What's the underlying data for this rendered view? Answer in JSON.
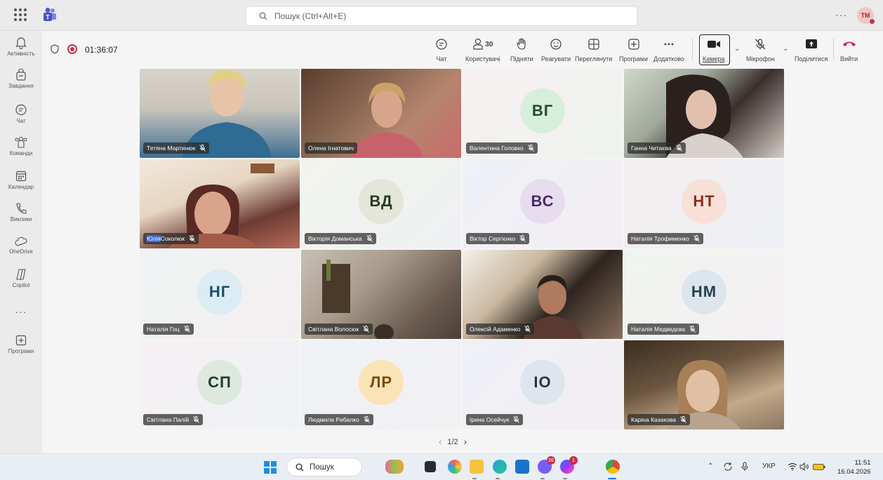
{
  "topbar": {
    "search_placeholder": "Пошук (Ctrl+Alt+E)",
    "more": "···",
    "user_initials": "TM"
  },
  "rail": [
    {
      "label": "Активність",
      "icon": "bell-icon"
    },
    {
      "label": "Завдання",
      "icon": "tasks-icon"
    },
    {
      "label": "Чат",
      "icon": "chat-icon"
    },
    {
      "label": "Команди",
      "icon": "teams-icon"
    },
    {
      "label": "Календар",
      "icon": "calendar-icon"
    },
    {
      "label": "Виклики",
      "icon": "phone-icon"
    },
    {
      "label": "OneDrive",
      "icon": "onedrive-icon"
    },
    {
      "label": "Copilot",
      "icon": "copilot-icon"
    },
    {
      "label": "···",
      "icon": "more-icon"
    },
    {
      "label": "Програми",
      "icon": "apps-add-icon"
    }
  ],
  "meeting": {
    "timer": "01:36:07",
    "controls": {
      "chat": "Чат",
      "people": "Користувачі",
      "people_count": "30",
      "raise": "Підняти",
      "react": "Реагувати",
      "view": "Переглянути",
      "apps": "Програми",
      "more": "Додатково",
      "camera": "Камера",
      "mic": "Мікрофон",
      "share": "Поділитися",
      "leave": "Вийти"
    }
  },
  "participants": [
    {
      "name": "Тетяна Мартинюк",
      "initials": "",
      "video": true,
      "muted": true
    },
    {
      "name": "Олена Ігнатович",
      "initials": "",
      "video": true,
      "muted": false
    },
    {
      "name": "Валентина Головко",
      "initials": "ВГ",
      "video": false,
      "muted": true,
      "avatar_bg": "#d7eedb",
      "avatar_fg": "#1e4d2b"
    },
    {
      "name": "Ганна Читаєва",
      "initials": "",
      "video": true,
      "muted": true
    },
    {
      "name_hl": "Юлія",
      "name_rest": " Соколюк",
      "name": "Юлія Соколюк",
      "initials": "",
      "video": true,
      "muted": true
    },
    {
      "name": "Вікторія Доманська",
      "initials": "ВД",
      "video": false,
      "muted": true,
      "avatar_bg": "#e3e6d9",
      "avatar_fg": "#2b3a20"
    },
    {
      "name": "Віктор Сергієнко",
      "initials": "ВС",
      "video": false,
      "muted": true,
      "avatar_bg": "#e8dcef",
      "avatar_fg": "#4a2a6a"
    },
    {
      "name": "Наталія Трофименко",
      "initials": "НТ",
      "video": false,
      "muted": true,
      "avatar_bg": "#f6e0d8",
      "avatar_fg": "#8a2f1b"
    },
    {
      "name": "Наталія Гоц",
      "initials": "НГ",
      "video": false,
      "muted": true,
      "avatar_bg": "#dcecf4",
      "avatar_fg": "#1b4f6b"
    },
    {
      "name": "Світлана Волосюк",
      "initials": "",
      "video": true,
      "muted": true
    },
    {
      "name": "Олексій Адаменко",
      "initials": "",
      "video": true,
      "muted": true
    },
    {
      "name": "Наталія Медведєва",
      "initials": "НМ",
      "video": false,
      "muted": true,
      "avatar_bg": "#dde6ec",
      "avatar_fg": "#24414f"
    },
    {
      "name": "Світлана Палій",
      "initials": "СП",
      "video": false,
      "muted": true,
      "avatar_bg": "#dde9df",
      "avatar_fg": "#1f3d27"
    },
    {
      "name": "Людмила Рибалко",
      "initials": "ЛР",
      "video": false,
      "muted": true,
      "avatar_bg": "#fbe3b8",
      "avatar_fg": "#7a4a00"
    },
    {
      "name": "Ірина Осейчук",
      "initials": "ІО",
      "video": false,
      "muted": true,
      "avatar_bg": "#dfe5ec",
      "avatar_fg": "#253545"
    },
    {
      "name": "Каріна Казакова",
      "initials": "",
      "video": true,
      "muted": true
    }
  ],
  "pager": {
    "text": "1/2",
    "prev": "‹",
    "next": "›"
  },
  "taskbar": {
    "search": "Пошук",
    "badges": {
      "viber": "26",
      "messenger": "1"
    },
    "tray": {
      "lang": "УКР"
    },
    "clock": {
      "time": "11:51",
      "date": "16.04.2026"
    }
  },
  "colors": {
    "record": "#c4314b",
    "leave": "#c4314b",
    "accent": "#5b5fc7"
  }
}
